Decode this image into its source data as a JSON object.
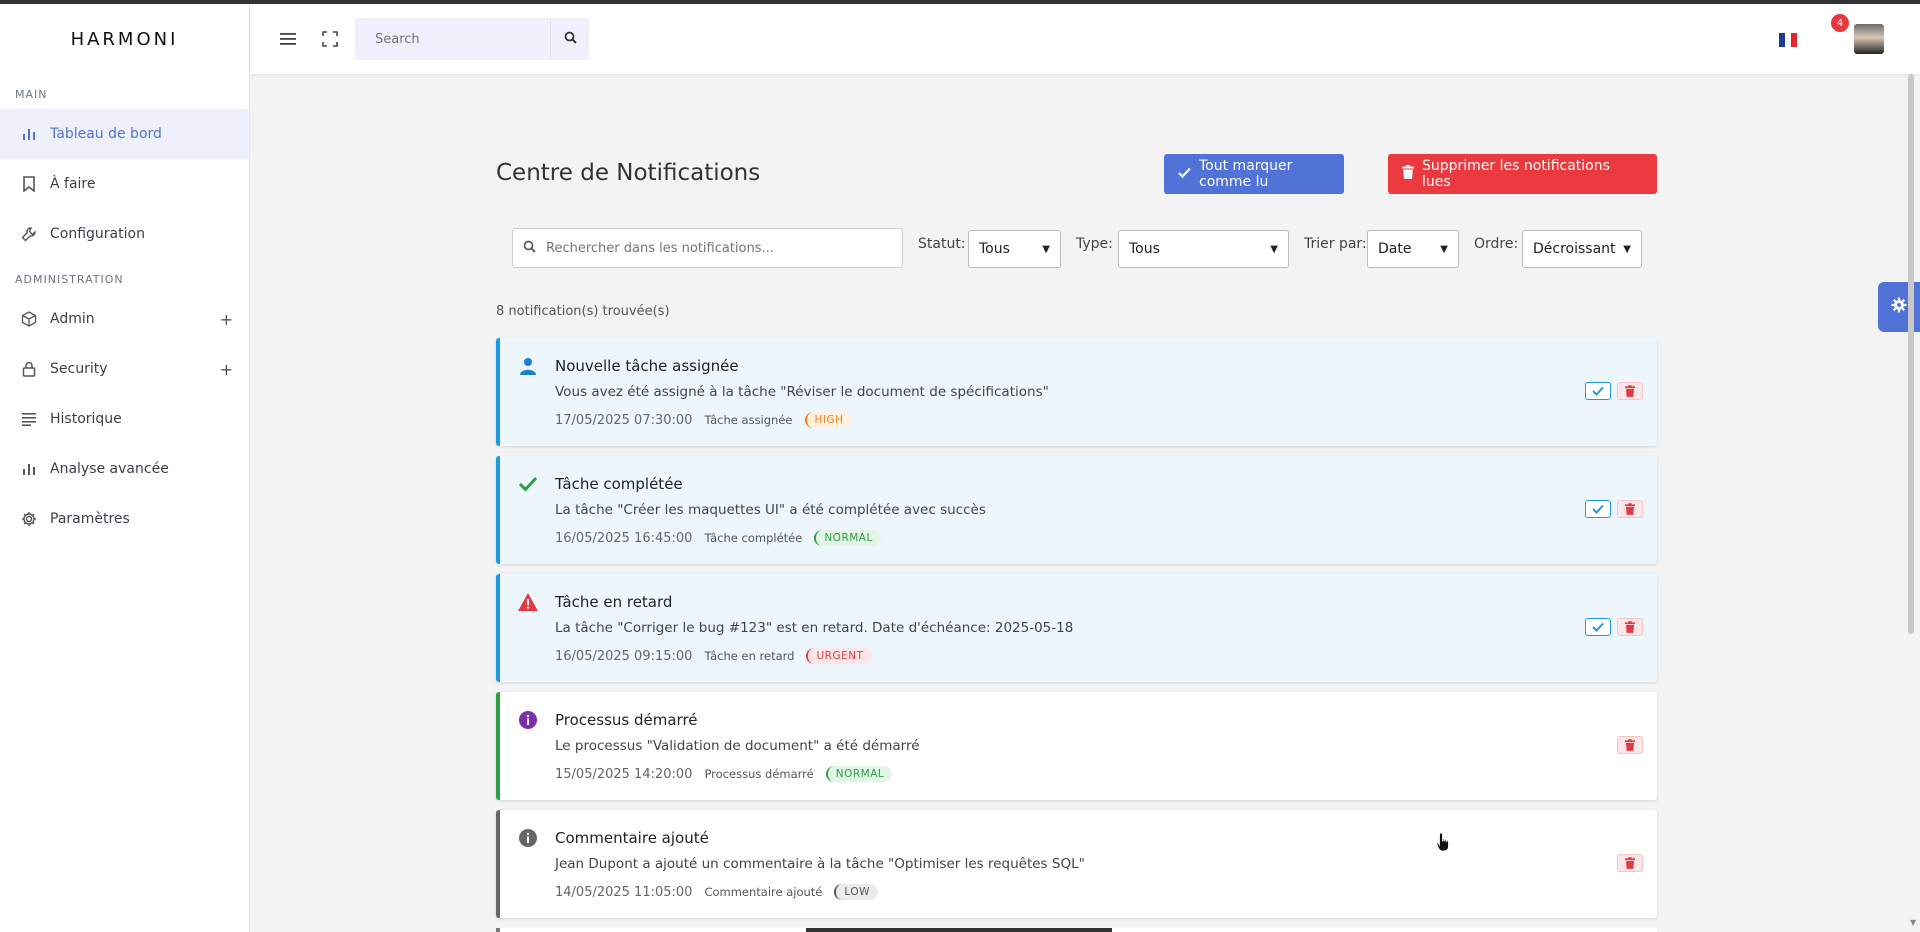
{
  "app": {
    "logo": "HARMONI"
  },
  "sidebar": {
    "sections": [
      {
        "label": "MAIN"
      },
      {
        "label": "ADMINISTRATION"
      }
    ],
    "items": [
      {
        "label": "Tableau de bord",
        "icon": "bar-chart-icon"
      },
      {
        "label": "À faire",
        "icon": "bookmark-icon"
      },
      {
        "label": "Configuration",
        "icon": "wrench-icon"
      },
      {
        "label": "Admin",
        "icon": "cube-icon",
        "expand": "+"
      },
      {
        "label": "Security",
        "icon": "lock-icon",
        "expand": "+"
      },
      {
        "label": "Historique",
        "icon": "list-icon"
      },
      {
        "label": "Analyse avancée",
        "icon": "bar-chart-icon"
      },
      {
        "label": "Paramètres",
        "icon": "gear-icon"
      }
    ]
  },
  "topbar": {
    "search_placeholder": "Search",
    "notification_count": "4",
    "language": "fr"
  },
  "page": {
    "title": "Centre de Notifications",
    "mark_all_label": "Tout marquer comme lu",
    "delete_read_label": "Supprimer les notifications lues",
    "count_label": "8 notification(s) trouvée(s)"
  },
  "filters": {
    "search_placeholder": "Rechercher dans les notifications...",
    "status_label": "Statut:",
    "status_value": "Tous",
    "type_label": "Type:",
    "type_value": "Tous",
    "sort_label": "Trier par:",
    "sort_value": "Date",
    "order_label": "Ordre:",
    "order_value": "Décroissant"
  },
  "notifications": [
    {
      "title": "Nouvelle tâche assignée",
      "message": "Vous avez été assigné à la tâche \"Réviser le document de spécifications\"",
      "datetime": "17/05/2025 07:30:00",
      "type": "Tâche assignée",
      "priority": "HIGH",
      "icon": "user-icon",
      "unread": true,
      "colors": {
        "icon": "#1e7fc8",
        "border": "#1e9be0"
      }
    },
    {
      "title": "Tâche complétée",
      "message": "La tâche \"Créer les maquettes UI\" a été complétée avec succès",
      "datetime": "16/05/2025 16:45:00",
      "type": "Tâche complétée",
      "priority": "NORMAL",
      "icon": "check-icon",
      "unread": true,
      "colors": {
        "icon": "#2e9d45",
        "border": "#1e9be0"
      }
    },
    {
      "title": "Tâche en retard",
      "message": "La tâche \"Corriger le bug #123\" est en retard. Date d'échéance: 2025-05-18",
      "datetime": "16/05/2025 09:15:00",
      "type": "Tâche en retard",
      "priority": "URGENT",
      "icon": "warning-icon",
      "unread": true,
      "colors": {
        "icon": "#e03b45",
        "border": "#1e9be0"
      }
    },
    {
      "title": "Processus démarré",
      "message": "Le processus \"Validation de document\" a été démarré",
      "datetime": "15/05/2025 14:20:00",
      "type": "Processus démarré",
      "priority": "NORMAL",
      "icon": "info-icon",
      "unread": false,
      "colors": {
        "icon": "#7b2fa8",
        "border": "#2e9d45"
      }
    },
    {
      "title": "Commentaire ajouté",
      "message": "Jean Dupont a ajouté un commentaire à la tâche \"Optimiser les requêtes SQL\"",
      "datetime": "14/05/2025 11:05:00",
      "type": "Commentaire ajouté",
      "priority": "LOW",
      "icon": "info-icon",
      "unread": false,
      "colors": {
        "icon": "#666666",
        "border": "#666666"
      }
    }
  ],
  "colors": {
    "accent": "#5173d8",
    "danger": "#ea3a3f",
    "unread_bg": "#eef6fd"
  }
}
